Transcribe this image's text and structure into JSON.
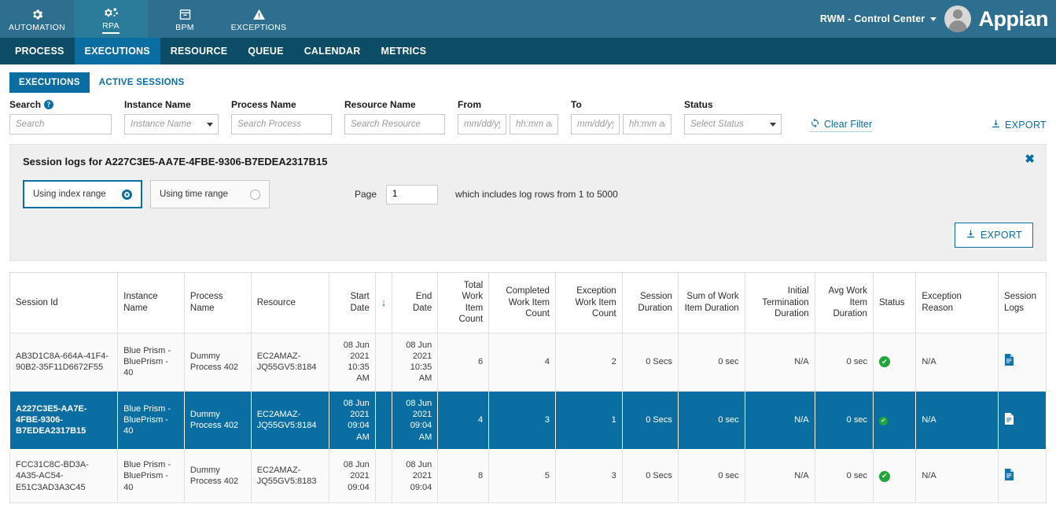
{
  "appbar": {
    "tabs": [
      {
        "label": "AUTOMATION",
        "icon": "gear-icon",
        "active": false
      },
      {
        "label": "RPA",
        "icon": "gears-icon",
        "active": true
      },
      {
        "label": "BPM",
        "icon": "archive-box-icon",
        "active": false
      },
      {
        "label": "EXCEPTIONS",
        "icon": "warning-triangle-icon",
        "active": false
      }
    ],
    "org_name": "RWM - Control Center",
    "brand": "Appian"
  },
  "subnav": {
    "items": [
      {
        "label": "PROCESS",
        "active": false
      },
      {
        "label": "EXECUTIONS",
        "active": true
      },
      {
        "label": "RESOURCE",
        "active": false
      },
      {
        "label": "QUEUE",
        "active": false
      },
      {
        "label": "CALENDAR",
        "active": false
      },
      {
        "label": "METRICS",
        "active": false
      }
    ]
  },
  "segment_tabs": [
    {
      "label": "EXECUTIONS",
      "active": true
    },
    {
      "label": "ACTIVE SESSIONS",
      "active": false
    }
  ],
  "filters": {
    "search": {
      "label": "Search",
      "placeholder": "Search",
      "value": "",
      "has_help": true
    },
    "instance_name": {
      "label": "Instance Name",
      "placeholder": "Instance Name",
      "value": ""
    },
    "process_name": {
      "label": "Process Name",
      "placeholder": "Search Process",
      "value": ""
    },
    "resource_name": {
      "label": "Resource Name",
      "placeholder": "Search Resource",
      "value": ""
    },
    "from": {
      "label": "From",
      "date_placeholder": "mm/dd/yy",
      "time_placeholder": "hh:mm ar",
      "date_value": "",
      "time_value": ""
    },
    "to": {
      "label": "To",
      "date_placeholder": "mm/dd/yy",
      "time_placeholder": "hh:mm ar",
      "date_value": "",
      "time_value": ""
    },
    "status": {
      "label": "Status",
      "placeholder": "Select Status",
      "value": ""
    },
    "clear_filter_label": "Clear Filter",
    "export_label": "EXPORT"
  },
  "panel": {
    "title": "Session logs for A227C3E5-AA7E-4FBE-9306-B7EDEA2317B15",
    "close_label": "✖",
    "range_options": [
      {
        "label": "Using index range",
        "selected": true
      },
      {
        "label": "Using time range",
        "selected": false
      }
    ],
    "page_label": "Page",
    "page_value": "1",
    "page_note": "which includes log rows from 1 to 5000",
    "export_label": "EXPORT"
  },
  "table": {
    "columns": [
      {
        "label": "Session Id",
        "align": "left"
      },
      {
        "label": "Instance Name",
        "align": "left"
      },
      {
        "label": "Process Name",
        "align": "left"
      },
      {
        "label": "Resource",
        "align": "left"
      },
      {
        "label": "Start Date",
        "align": "right"
      },
      {
        "label": "",
        "align": "center",
        "icon": "sort-descending-arrow-icon"
      },
      {
        "label": "End Date",
        "align": "right"
      },
      {
        "label": "Total Work Item Count",
        "align": "right"
      },
      {
        "label": "Completed Work Item Count",
        "align": "right"
      },
      {
        "label": "Exception Work Item Count",
        "align": "right"
      },
      {
        "label": "Session Duration",
        "align": "right"
      },
      {
        "label": "Sum of Work Item Duration",
        "align": "right"
      },
      {
        "label": "Initial Termination Duration",
        "align": "right"
      },
      {
        "label": "Avg Work Item Duration",
        "align": "right"
      },
      {
        "label": "Status",
        "align": "left"
      },
      {
        "label": "Exception Reason",
        "align": "left"
      },
      {
        "label": "Session Logs",
        "align": "left"
      }
    ],
    "sort_arrow": "↓",
    "rows": [
      {
        "selected": false,
        "session_id": "AB3D1C8A-664A-41F4-90B2-35F11D6672F55",
        "instance_name": "Blue Prism - BluePrism - 40",
        "process_name": "Dummy Process 402",
        "resource": "EC2AMAZ-JQ55GV5:8184",
        "start_date": "08 Jun 2021 10:35 AM",
        "end_date": "08 Jun 2021 10:35 AM",
        "total_work_item_count": "6",
        "completed_work_item_count": "4",
        "exception_work_item_count": "2",
        "session_duration": "0 Secs",
        "sum_of_work_item_duration": "0 sec",
        "initial_termination_duration": "N/A",
        "avg_work_item_duration": "0 sec",
        "status": "success",
        "exception_reason": "N/A",
        "session_logs": "document-icon"
      },
      {
        "selected": true,
        "session_id": "A227C3E5-AA7E-4FBE-9306-B7EDEA2317B15",
        "instance_name": "Blue Prism - BluePrism - 40",
        "process_name": "Dummy Process 402",
        "resource": "EC2AMAZ-JQ55GV5:8184",
        "start_date": "08 Jun 2021 09:04 AM",
        "end_date": "08 Jun 2021 09:04 AM",
        "total_work_item_count": "4",
        "completed_work_item_count": "3",
        "exception_work_item_count": "1",
        "session_duration": "0 Secs",
        "sum_of_work_item_duration": "0 sec",
        "initial_termination_duration": "N/A",
        "avg_work_item_duration": "0 sec",
        "status": "success",
        "exception_reason": "N/A",
        "session_logs": "document-icon"
      },
      {
        "selected": false,
        "session_id": "FCC31C8C-BD3A-4A35-AC54-E51C3AD3A3C45",
        "instance_name": "Blue Prism - BluePrism - 40",
        "process_name": "Dummy Process 402",
        "resource": "EC2AMAZ-JQ55GV5:8183",
        "start_date": "08 Jun 2021 09:04",
        "end_date": "08 Jun 2021 09:04",
        "total_work_item_count": "8",
        "completed_work_item_count": "5",
        "exception_work_item_count": "3",
        "session_duration": "0 Secs",
        "sum_of_work_item_duration": "0 sec",
        "initial_termination_duration": "N/A",
        "avg_work_item_duration": "0 sec",
        "status": "success",
        "exception_reason": "N/A",
        "session_logs": "document-icon"
      }
    ]
  },
  "colors": {
    "appbar": "#2e6e8e",
    "appbar_active": "#2b7b9b",
    "subnav": "#0d4c66",
    "accent": "#0a6ea3",
    "success": "#22a63a"
  }
}
